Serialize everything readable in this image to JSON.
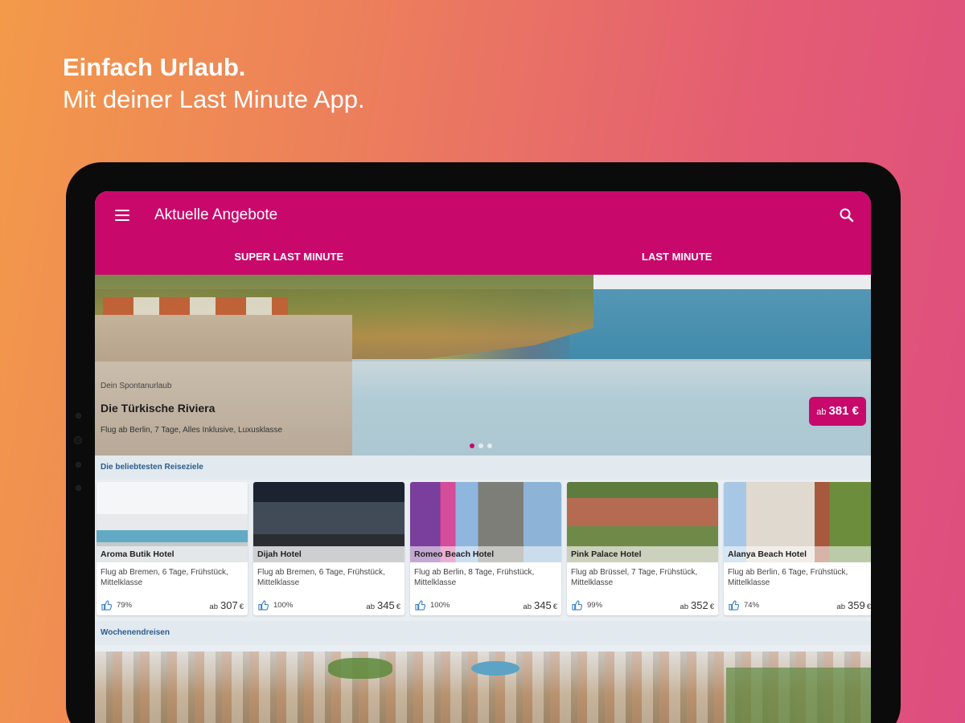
{
  "headline": {
    "line1": "Einfach Urlaub.",
    "line2": "Mit deiner Last Minute App."
  },
  "appbar": {
    "title": "Aktuelle Angebote",
    "menu_icon": "menu-icon",
    "search_icon": "search-icon"
  },
  "tabs": [
    {
      "label": "SUPER LAST MINUTE"
    },
    {
      "label": "LAST MINUTE"
    }
  ],
  "hero": {
    "eyebrow": "Dein Spontanurlaub",
    "title": "Die Türkische Riviera",
    "subtitle": "Flug ab Berlin, 7 Tage, Alles Inklusive, Luxusklasse",
    "price_prefix": "ab",
    "price": "381 €",
    "slide_count": 3,
    "active_slide": 1
  },
  "popular": {
    "label": "Die beliebtesten Reiseziele",
    "cards": [
      {
        "name": "Aroma Butik Hotel",
        "desc": "Flug ab Bremen, 6 Tage, Frühstück, Mittelklasse",
        "rating": "79%",
        "price_prefix": "ab",
        "price": "307",
        "currency": "€"
      },
      {
        "name": "Dijah Hotel",
        "desc": "Flug ab Bremen, 6 Tage, Frühstück, Mittelklasse",
        "rating": "100%",
        "price_prefix": "ab",
        "price": "345",
        "currency": "€"
      },
      {
        "name": "Romeo Beach Hotel",
        "desc": "Flug ab Berlin, 8 Tage, Frühstück, Mittelklasse",
        "rating": "100%",
        "price_prefix": "ab",
        "price": "345",
        "currency": "€"
      },
      {
        "name": "Pink Palace Hotel",
        "desc": "Flug ab Brüssel, 7 Tage, Frühstück, Mittelklasse",
        "rating": "99%",
        "price_prefix": "ab",
        "price": "352",
        "currency": "€"
      },
      {
        "name": "Alanya Beach Hotel",
        "desc": "Flug ab Berlin, 6 Tage, Frühstück, Mittelklasse",
        "rating": "74%",
        "price_prefix": "ab",
        "price": "359",
        "currency": "€"
      }
    ]
  },
  "weekend": {
    "label": "Wochenendreisen"
  },
  "colors": {
    "brand": "#c8096b",
    "section_label": "#2a5d8e"
  }
}
